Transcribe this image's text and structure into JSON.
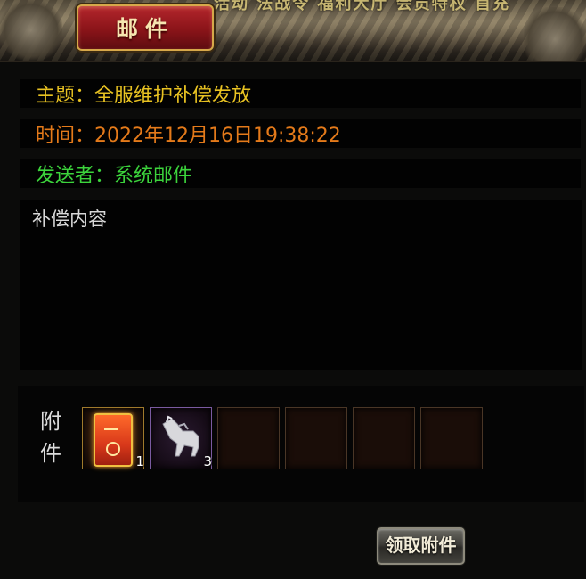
{
  "header": {
    "title": "邮件",
    "nav_strip_text": "活动 法战令 福利大厅 会员特权 首充"
  },
  "mail": {
    "subject_label": "主题：",
    "subject_value": "全服维护补偿发放",
    "time_label": "时间：",
    "time_value": "2022年12月16日19:38:22",
    "sender_label": "发送者：",
    "sender_value": "系统邮件",
    "content_text": "补偿内容"
  },
  "attachments": {
    "label_line1": "附",
    "label_line2": "件",
    "slots": [
      {
        "item": "red-card",
        "count": "1"
      },
      {
        "item": "white-horse-mount",
        "count": "3"
      },
      {
        "item": "",
        "count": ""
      },
      {
        "item": "",
        "count": ""
      },
      {
        "item": "",
        "count": ""
      },
      {
        "item": "",
        "count": ""
      }
    ]
  },
  "buttons": {
    "claim_label": "领取附件"
  },
  "colors": {
    "subject": "#e8c222",
    "time": "#e47a1a",
    "sender": "#3cd43c"
  }
}
